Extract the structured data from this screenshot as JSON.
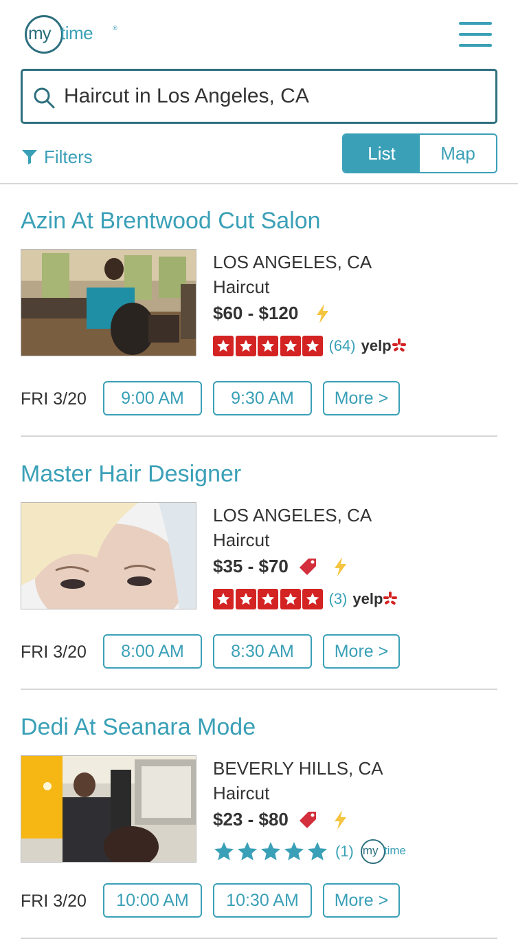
{
  "header": {
    "logo_my": "my",
    "logo_time": "time",
    "logo_reg": "®"
  },
  "search": {
    "value": "Haircut in Los Angeles, CA"
  },
  "toolbar": {
    "filters_label": "Filters",
    "list_label": "List",
    "map_label": "Map",
    "active_view": "List"
  },
  "results": [
    {
      "name": "Azin At Brentwood Cut Salon",
      "city": "LOS ANGELES, CA",
      "service": "Haircut",
      "price": "$60 - $120",
      "has_deal_tag": false,
      "instant_book": true,
      "rating_source": "yelp",
      "rating": 5,
      "review_count": "(64)",
      "day": "FRI 3/20",
      "slots": [
        "9:00 AM",
        "9:30 AM"
      ],
      "more_label": "More >"
    },
    {
      "name": "Master Hair Designer",
      "city": "LOS ANGELES, CA",
      "service": "Haircut",
      "price": "$35 - $70",
      "has_deal_tag": true,
      "instant_book": true,
      "rating_source": "yelp",
      "rating": 5,
      "review_count": "(3)",
      "day": "FRI 3/20",
      "slots": [
        "8:00 AM",
        "8:30 AM"
      ],
      "more_label": "More >"
    },
    {
      "name": "Dedi At Seanara Mode",
      "city": "BEVERLY HILLS, CA",
      "service": "Haircut",
      "price": "$23 - $80",
      "has_deal_tag": true,
      "instant_book": true,
      "rating_source": "mytime",
      "rating": 5,
      "review_count": "(1)",
      "day": "FRI 3/20",
      "slots": [
        "10:00 AM",
        "10:30 AM"
      ],
      "more_label": "More >"
    }
  ],
  "colors": {
    "accent": "#3aa0b7",
    "dark_teal": "#2d6f7e",
    "yelp_red": "#d32323",
    "lightning": "#f5c542"
  }
}
